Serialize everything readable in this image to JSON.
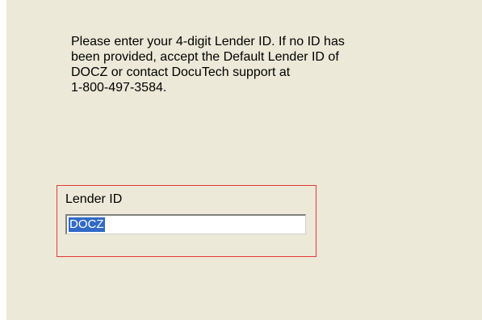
{
  "dialog": {
    "instructions": "Please enter your 4-digit Lender ID. If no ID has\nbeen provided, accept the Default Lender ID of\nDOCZ or contact DocuTech support at\n1-800-497-3584."
  },
  "lender_id_field": {
    "label": "Lender ID",
    "value": "DOCZ",
    "highlight_color": "#e53935",
    "selection_color": "#316ac5"
  }
}
